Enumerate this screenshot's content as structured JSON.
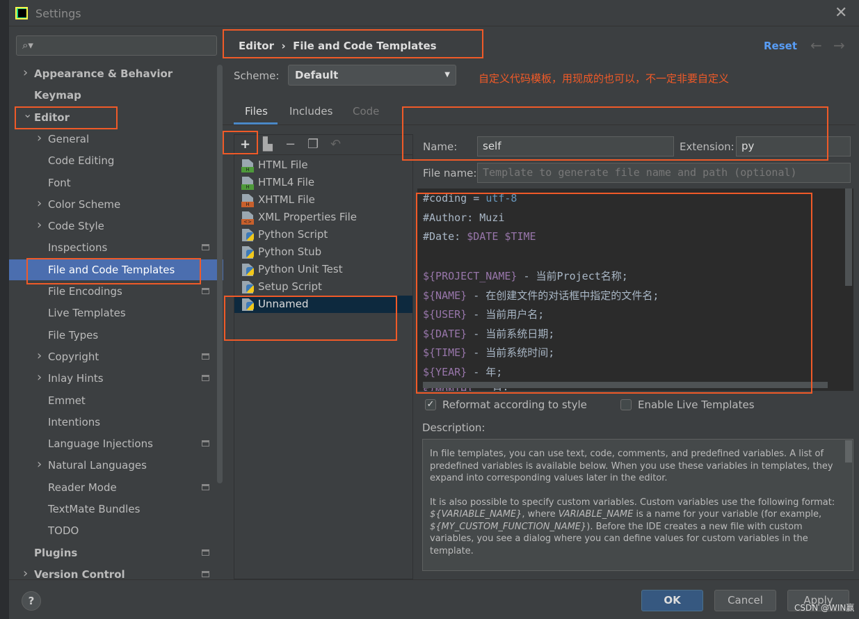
{
  "window": {
    "title": "Settings",
    "logo_text": "PC"
  },
  "search": {
    "placeholder": ""
  },
  "sidebar": {
    "items": [
      {
        "label": "Appearance & Behavior",
        "level": 0,
        "arrow": "right",
        "bold": true
      },
      {
        "label": "Keymap",
        "level": 0,
        "bold": true
      },
      {
        "label": "Editor",
        "level": 0,
        "arrow": "down",
        "bold": true
      },
      {
        "label": "General",
        "level": 1,
        "arrow": "right"
      },
      {
        "label": "Code Editing",
        "level": 1
      },
      {
        "label": "Font",
        "level": 1
      },
      {
        "label": "Color Scheme",
        "level": 1,
        "arrow": "right"
      },
      {
        "label": "Code Style",
        "level": 1,
        "arrow": "right"
      },
      {
        "label": "Inspections",
        "level": 1,
        "page_icon": true
      },
      {
        "label": "File and Code Templates",
        "level": 1,
        "selected": true
      },
      {
        "label": "File Encodings",
        "level": 1,
        "page_icon": true
      },
      {
        "label": "Live Templates",
        "level": 1
      },
      {
        "label": "File Types",
        "level": 1
      },
      {
        "label": "Copyright",
        "level": 1,
        "arrow": "right",
        "page_icon": true
      },
      {
        "label": "Inlay Hints",
        "level": 1,
        "arrow": "right",
        "page_icon": true
      },
      {
        "label": "Emmet",
        "level": 1
      },
      {
        "label": "Intentions",
        "level": 1
      },
      {
        "label": "Language Injections",
        "level": 1,
        "page_icon": true
      },
      {
        "label": "Natural Languages",
        "level": 1,
        "arrow": "right"
      },
      {
        "label": "Reader Mode",
        "level": 1,
        "page_icon": true
      },
      {
        "label": "TextMate Bundles",
        "level": 1
      },
      {
        "label": "TODO",
        "level": 1
      },
      {
        "label": "Plugins",
        "level": 0,
        "bold": true,
        "page_icon": true
      },
      {
        "label": "Version Control",
        "level": 0,
        "arrow": "right",
        "bold": true,
        "page_icon": true
      }
    ]
  },
  "header": {
    "breadcrumb": [
      "Editor",
      "File and Code Templates"
    ],
    "separator": "›",
    "reset": "Reset"
  },
  "scheme": {
    "label": "Scheme:",
    "value": "Default"
  },
  "annotation": "自定义代码模板，用现成的也可以，不一定非要自定义",
  "tabs": [
    {
      "label": "Files",
      "active": true
    },
    {
      "label": "Includes"
    },
    {
      "label": "Code",
      "disabled": true
    }
  ],
  "templates": [
    {
      "label": "HTML File",
      "icon": "html",
      "badge": "H",
      "color": "#4e9a3a"
    },
    {
      "label": "HTML4 File",
      "icon": "html",
      "badge": "H",
      "color": "#4e9a3a"
    },
    {
      "label": "XHTML File",
      "icon": "html",
      "badge": "H",
      "color": "#c8602c"
    },
    {
      "label": "XML Properties File",
      "icon": "xml",
      "badge": "<>",
      "color": "#c8602c"
    },
    {
      "label": "Python Script",
      "icon": "python"
    },
    {
      "label": "Python Stub",
      "icon": "python"
    },
    {
      "label": "Python Unit Test",
      "icon": "python"
    },
    {
      "label": "Setup Script",
      "icon": "python"
    },
    {
      "label": "Unnamed",
      "icon": "python",
      "selected": true
    }
  ],
  "form": {
    "name_label": "Name:",
    "name_value": "self",
    "ext_label": "Extension:",
    "ext_value": "py",
    "filename_label": "File name:",
    "filename_placeholder": "Template to generate file name and path (optional)"
  },
  "code": [
    [
      {
        "t": "#coding = ",
        "c": "#a9b7c6"
      },
      {
        "t": "utf-8",
        "c": "#6897bb"
      }
    ],
    [
      {
        "t": "#Author: Muzi",
        "c": "#a9b7c6"
      }
    ],
    [
      {
        "t": "#Date: ",
        "c": "#a9b7c6"
      },
      {
        "t": "$DATE $TIME",
        "c": "#9876aa"
      }
    ],
    [],
    [
      {
        "t": "${PROJECT_NAME}",
        "c": "#9876aa"
      },
      {
        "t": " - 当前Project名称;",
        "c": "#a9b7c6"
      }
    ],
    [
      {
        "t": "${NAME}",
        "c": "#9876aa"
      },
      {
        "t": " - 在创建文件的对话框中指定的文件名;",
        "c": "#a9b7c6"
      }
    ],
    [
      {
        "t": "${USER}",
        "c": "#9876aa"
      },
      {
        "t": " - 当前用户名;",
        "c": "#a9b7c6"
      }
    ],
    [
      {
        "t": "${DATE}",
        "c": "#9876aa"
      },
      {
        "t": " - 当前系统日期;",
        "c": "#a9b7c6"
      }
    ],
    [
      {
        "t": "${TIME}",
        "c": "#9876aa"
      },
      {
        "t": " - 当前系统时间;",
        "c": "#a9b7c6"
      }
    ],
    [
      {
        "t": "${YEAR}",
        "c": "#9876aa"
      },
      {
        "t": " - 年;",
        "c": "#a9b7c6"
      }
    ],
    [
      {
        "t": "${MONTH}",
        "c": "#9876aa"
      },
      {
        "t": " - 月;",
        "c": "#a9b7c6"
      }
    ]
  ],
  "options": {
    "reformat": {
      "label": "Reformat according to style",
      "checked": true
    },
    "live_templates": {
      "label": "Enable Live Templates",
      "checked": false
    }
  },
  "description": {
    "label": "Description:",
    "p1": "In file templates, you can use text, code, comments, and predefined variables. A list of predefined variables is available below. When you use these variables in templates, they expand into corresponding values later in the editor.",
    "p2a": "It is also possible to specify custom variables. Custom variables use the following format: ",
    "v1": "${VARIABLE_NAME}",
    "p2b": ", where ",
    "v2": "VARIABLE_NAME",
    "p2c": " is a name for your variable (for example, ",
    "v3": "${MY_CUSTOM_FUNCTION_NAME}",
    "p2d": "). Before the IDE creates a new file with custom variables, you see a dialog where you can define values for custom variables in the template."
  },
  "buttons": {
    "help": "?",
    "ok": "OK",
    "cancel": "Cancel",
    "apply": "Apply"
  },
  "watermark": "CSDN @WIN赢",
  "colors": {
    "accent": "#4b6eaf",
    "annotation": "#f05a28",
    "link": "#589df6"
  }
}
